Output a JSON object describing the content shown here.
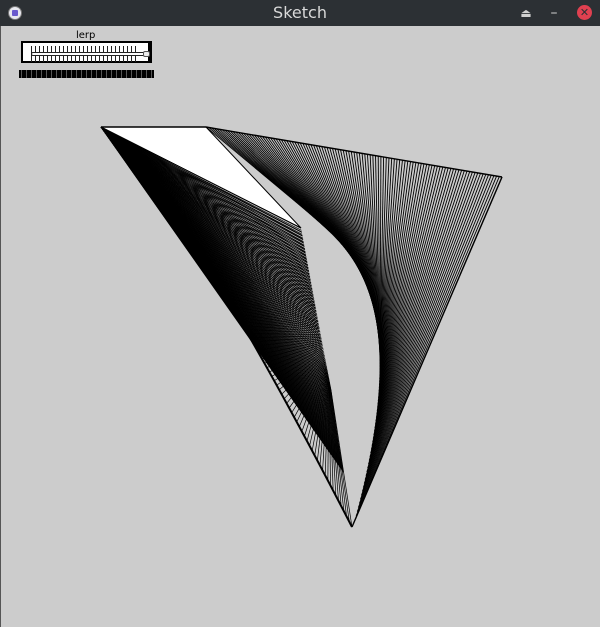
{
  "window": {
    "title": "Sketch",
    "controls": [
      "eject-icon",
      "minimize-icon",
      "close-icon"
    ],
    "close_color": "#e04050"
  },
  "slider": {
    "label": "lerp",
    "value_fraction": 0.97
  },
  "colors": {
    "titlebar": "#2c3034",
    "canvas_bg": "#cccccc",
    "stroke": "#000000",
    "fill": "#ffffff"
  }
}
